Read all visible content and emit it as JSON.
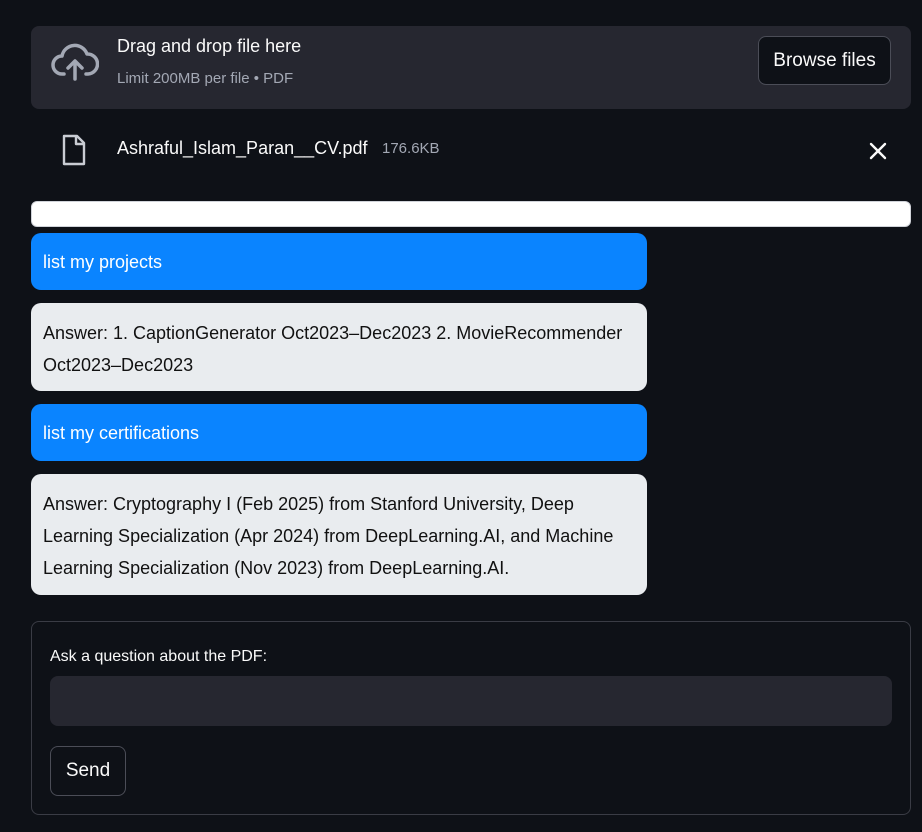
{
  "uploader": {
    "title": "Drag and drop file here",
    "subtitle": "Limit 200MB per file • PDF",
    "browse_label": "Browse files",
    "icon": "cloud-upload-icon"
  },
  "file": {
    "name": "Ashraful_Islam_Paran__CV.pdf",
    "size": "176.6KB",
    "icon": "file-icon",
    "remove_icon": "close-icon"
  },
  "progress": {
    "value": 1.0
  },
  "chat": [
    {
      "role": "user",
      "text": "list my projects"
    },
    {
      "role": "bot",
      "text": "Answer: 1. CaptionGenerator Oct2023–Dec2023 2. MovieRecommender Oct2023–Dec2023"
    },
    {
      "role": "user",
      "text": "list my certifications"
    },
    {
      "role": "bot",
      "text": "Answer: Cryptography I (Feb 2025) from Stanford University, Deep Learning Specialization (Apr 2024) from DeepLearning.AI, and Machine Learning Specialization (Nov 2023) from DeepLearning.AI."
    }
  ],
  "form": {
    "label": "Ask a question about the PDF:",
    "input_value": "",
    "send_label": "Send"
  },
  "colors": {
    "background": "#0e1117",
    "panel": "#262730",
    "user_bubble": "#0a84ff",
    "bot_bubble": "#e9ecef"
  }
}
